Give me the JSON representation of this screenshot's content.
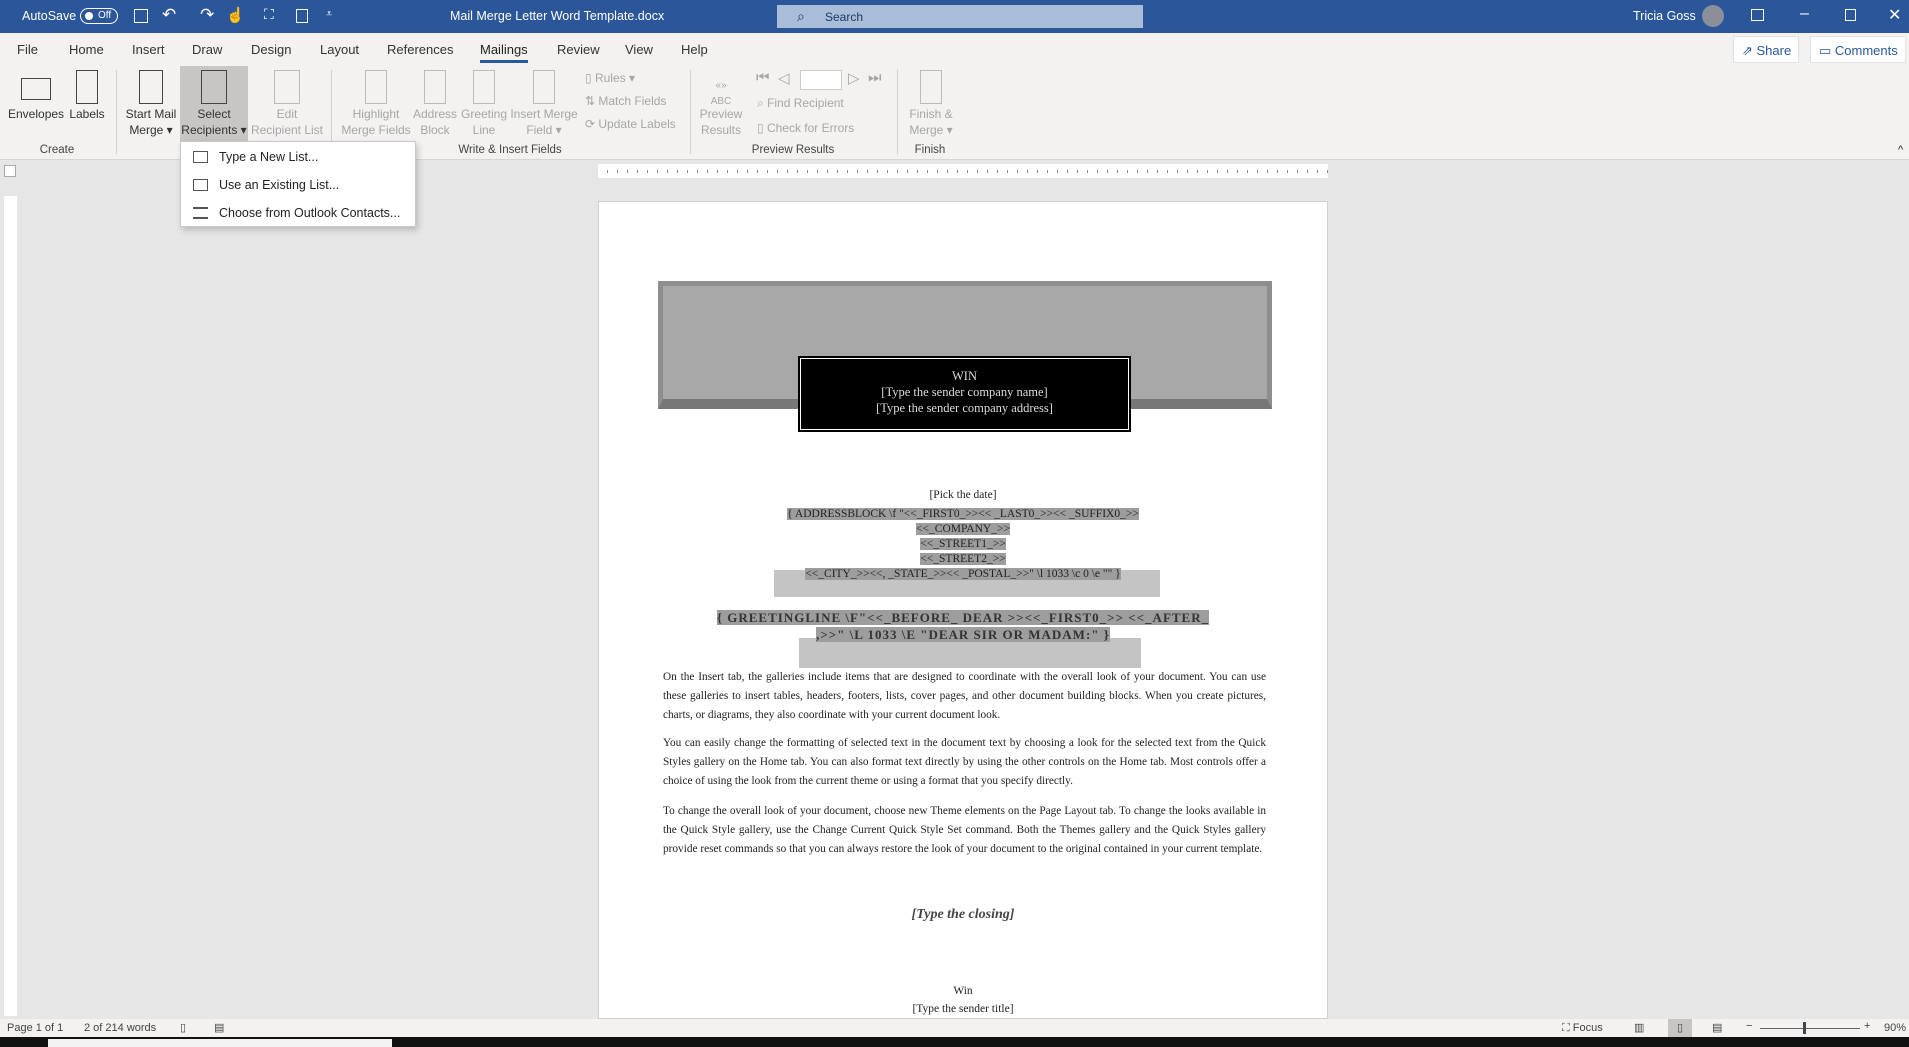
{
  "titlebar": {
    "autosave": "AutoSave",
    "autosave_state": "Off",
    "doc_title": "Mail Merge Letter Word Template.docx",
    "search_placeholder": "Search",
    "user": "Tricia Goss"
  },
  "tabs": [
    "File",
    "Home",
    "Insert",
    "Draw",
    "Design",
    "Layout",
    "References",
    "Mailings",
    "Review",
    "View",
    "Help"
  ],
  "active_tab": "Mailings",
  "share": "Share",
  "comments": "Comments",
  "ribbon": {
    "envelopes": "Envelopes",
    "labels": "Labels",
    "start_mail_merge": [
      "Start Mail",
      "Merge ▾"
    ],
    "select_recipients": [
      "Select",
      "Recipients ▾"
    ],
    "edit_recipient_list": [
      "Edit",
      "Recipient List"
    ],
    "highlight": [
      "Highlight",
      "Merge Fields"
    ],
    "address_block": [
      "Address",
      "Block"
    ],
    "greeting_line": [
      "Greeting",
      "Line"
    ],
    "insert_merge_field": [
      "Insert Merge",
      "Field ▾"
    ],
    "rules": "Rules ▾",
    "match_fields": "Match Fields",
    "update_labels": "Update Labels",
    "preview_results": [
      "Preview",
      "Results"
    ],
    "find_recipient": "Find Recipient",
    "check_errors": "Check for Errors",
    "finish_merge": [
      "Finish &",
      "Merge ▾"
    ],
    "groups": {
      "create": "Create",
      "write_insert": "Write & Insert Fields",
      "preview": "Preview Results",
      "finish": "Finish"
    }
  },
  "menu": [
    "Type a New List...",
    "Use an Existing List...",
    "Choose from Outlook Contacts..."
  ],
  "document": {
    "banner": [
      "WIN",
      "[Type the sender company name]",
      "[Type the sender company address]"
    ],
    "date": "[Pick the date]",
    "address_block": [
      "{ ADDRESSBLOCK \\f \"<<_FIRST0_>><< _LAST0_>><< _SUFFIX0_>>",
      "<<_COMPANY_>>",
      "<<_STREET1_>>",
      "<<_STREET2_>>",
      "<<_CITY_>><<, _STATE_>><< _POSTAL_>>\" \\l 1033 \\c 0 \\e \"\" }"
    ],
    "greeting": [
      "{ GREETINGLINE \\F\"<<_BEFORE_ DEAR >><<_FIRST0_>> <<_AFTER_",
      ",>>\" \\L 1033 \\E \"DEAR SIR OR MADAM:\" }"
    ],
    "paragraphs": [
      "On the Insert tab, the galleries include items that are designed to coordinate with the overall look of your document. You can use these galleries to insert tables, headers, footers, lists, cover pages, and other document building blocks. When you create pictures, charts, or diagrams, they also coordinate with your current document look.",
      "You can easily change the formatting of selected text in the document text by choosing a look for the selected text from the Quick Styles gallery on the Home tab. You can also format text directly by using the other controls on the Home tab. Most controls offer a choice of using the look from the current theme or using a format that you specify directly.",
      "To change the overall look of your document, choose new Theme elements on the Page Layout tab. To change the looks available in the Quick Style gallery, use the Change Current Quick Style Set command. Both the Themes gallery and the Quick Styles gallery provide reset commands so that you can always restore the look of your document to the original contained in your current template."
    ],
    "closing": "[Type the closing]",
    "sender_name": "Win",
    "sender_title": "[Type the sender title]"
  },
  "status": {
    "page": "Page 1 of 1",
    "words": "2 of 214 words",
    "focus": "Focus",
    "zoom": "90%"
  },
  "colors": {
    "accent": "#2b579a"
  }
}
